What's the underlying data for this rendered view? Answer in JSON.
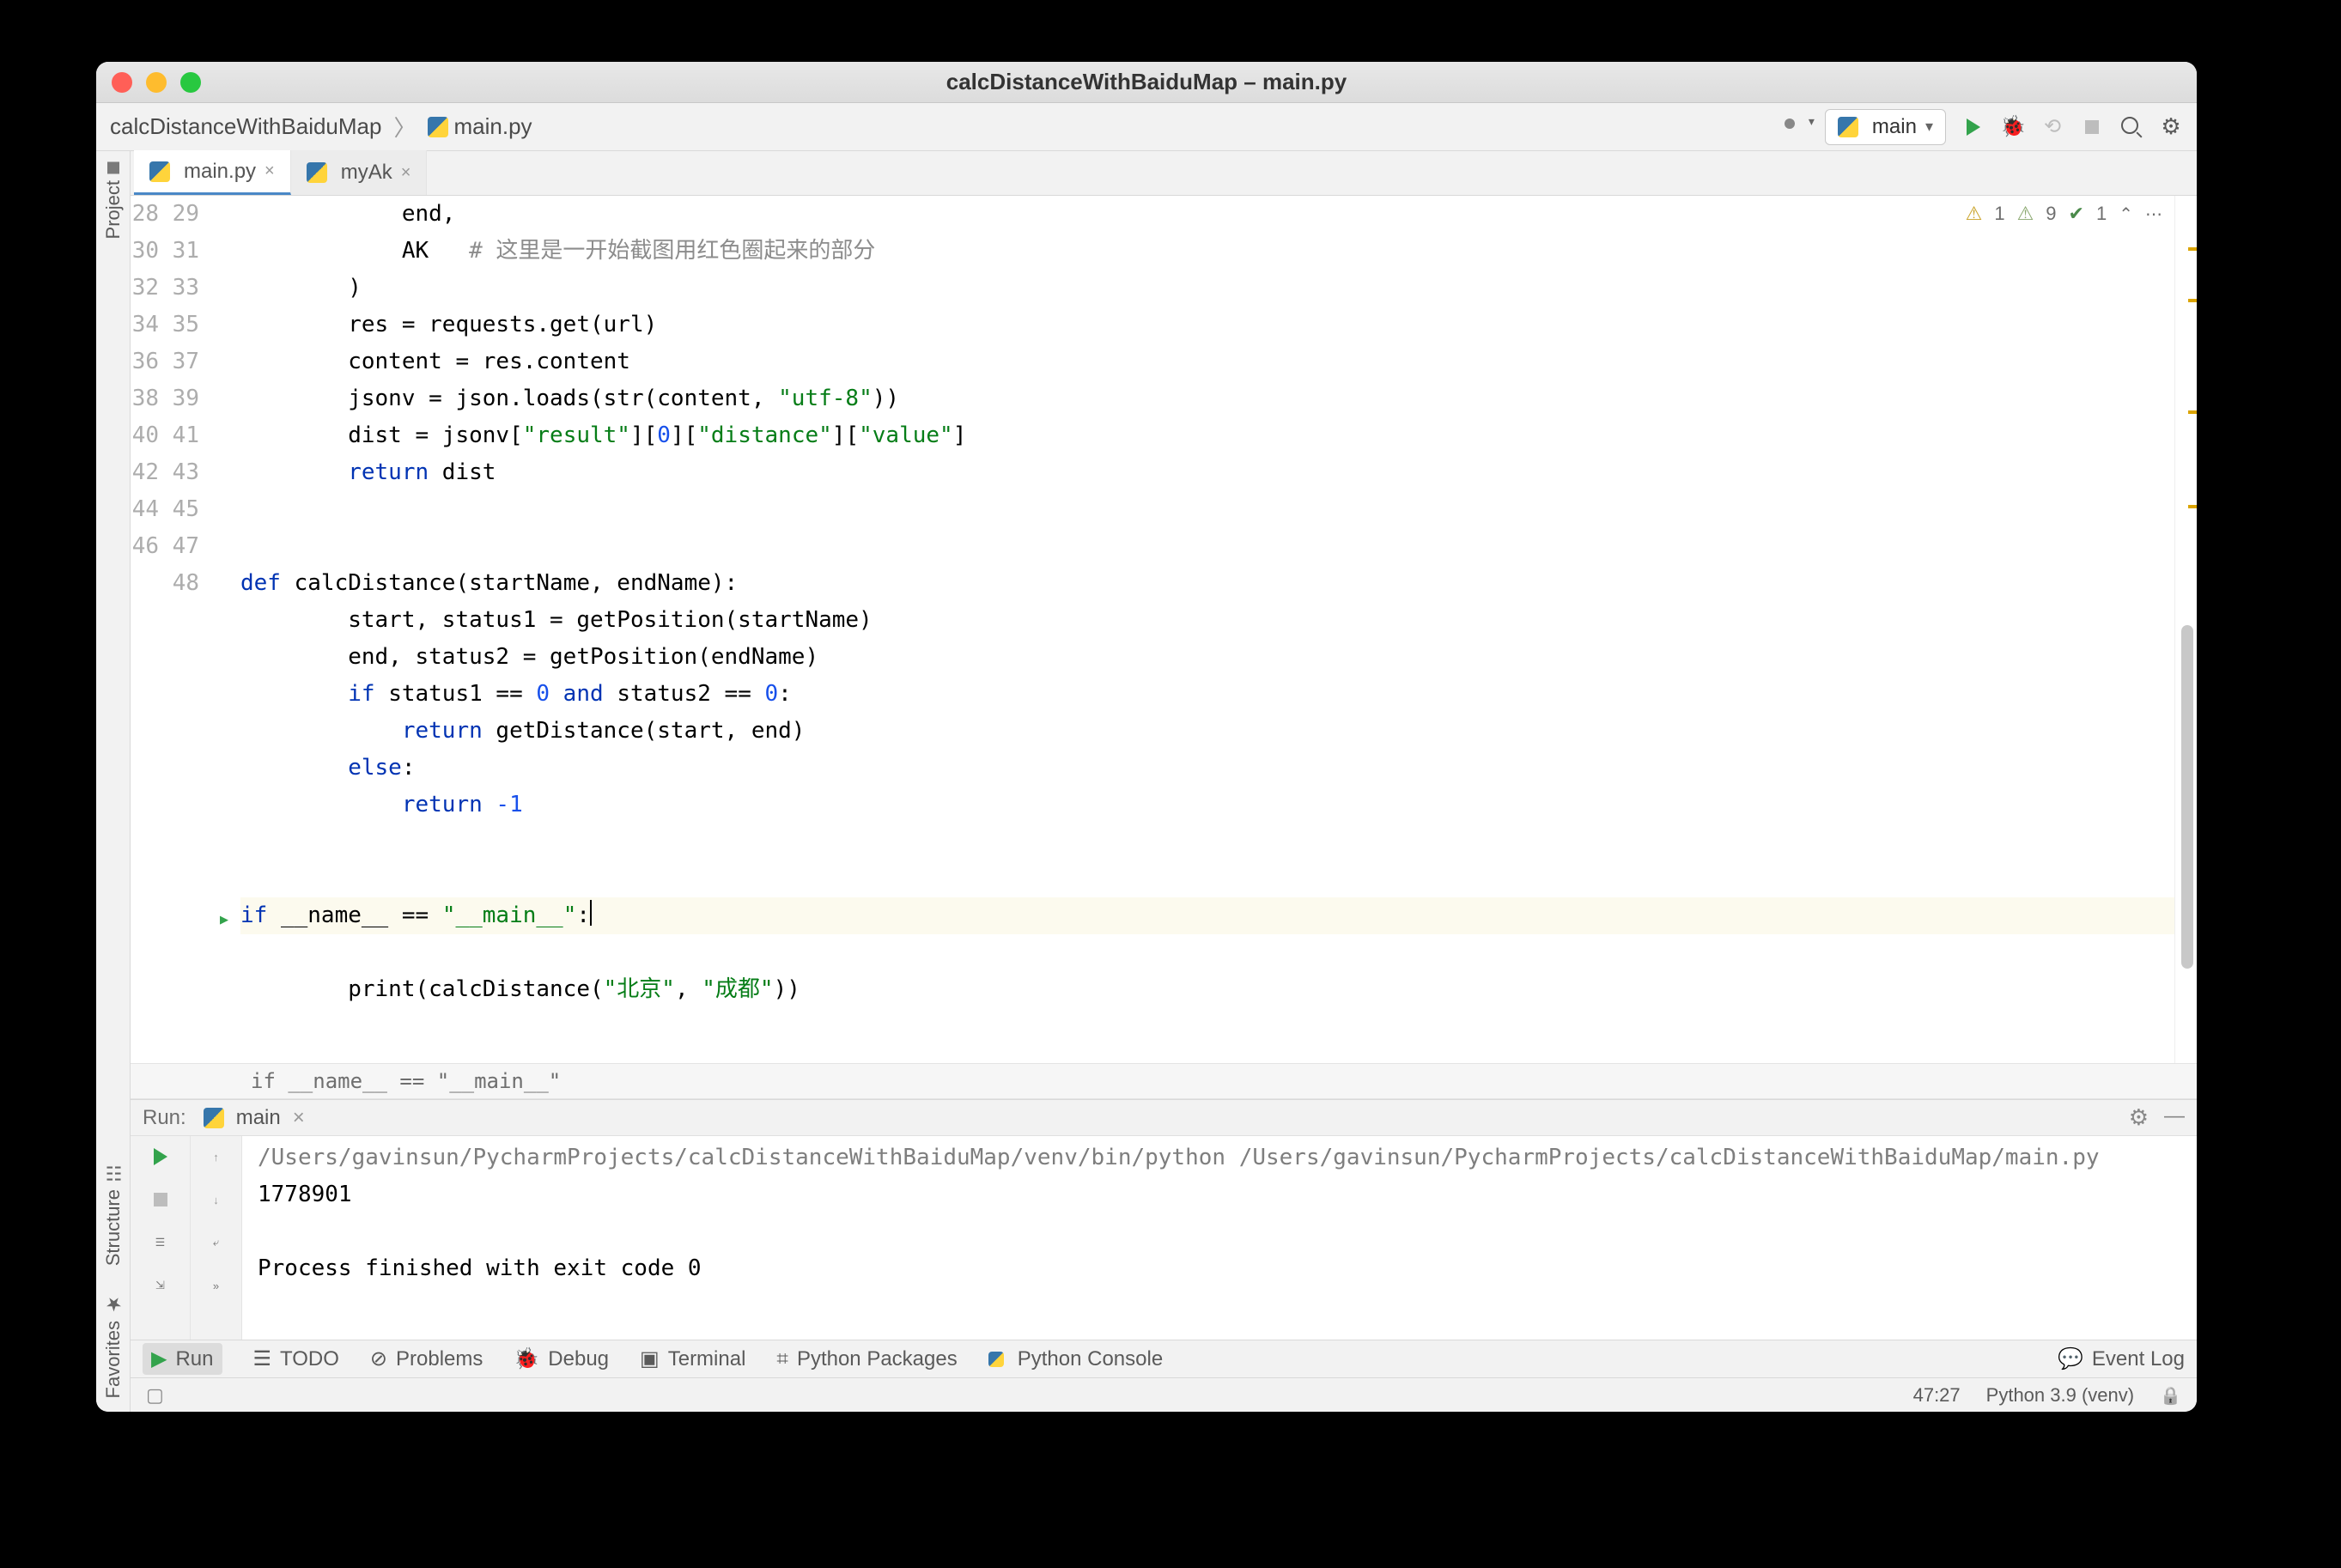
{
  "window": {
    "title": "calcDistanceWithBaiduMap – main.py"
  },
  "breadcrumb": {
    "project": "calcDistanceWithBaiduMap",
    "file": "main.py"
  },
  "runConfig": {
    "name": "main"
  },
  "tabs": [
    {
      "label": "main.py",
      "active": true
    },
    {
      "label": "myAk",
      "active": false
    }
  ],
  "inspections": {
    "warnings": "1",
    "typos": "9",
    "ok": "1"
  },
  "gutter": {
    "start": 28,
    "end": 48
  },
  "code": {
    "l28": "            end,",
    "l29a": "            AK   ",
    "l29b": "# 这里是一开始截图用红色圈起来的部分",
    "l30": "        )",
    "l31": "        res = requests.get(url)",
    "l32": "        content = res.content",
    "l33_pre": "        jsonv = json.loads(",
    "l33_str": "str",
    "l33_mid": "(content, ",
    "l33_s": "\"utf-8\"",
    "l33_post": "))",
    "l34_pre": "        dist = jsonv[",
    "l34_s1": "\"result\"",
    "l34_b1": "][",
    "l34_n": "0",
    "l34_b2": "][",
    "l34_s2": "\"distance\"",
    "l34_b3": "][",
    "l34_s3": "\"value\"",
    "l34_post": "]",
    "l35_kw": "        return",
    "l35_rest": " dist",
    "l38_kw": "def ",
    "l38_rest": "calcDistance(startName, endName):",
    "l39": "        start, status1 = getPosition(startName)",
    "l40": "        end, status2 = getPosition(endName)",
    "l41_if": "        if ",
    "l41_a": "status1 == ",
    "l41_n1": "0",
    "l41_and": " and ",
    "l41_b": "status2 == ",
    "l41_n2": "0",
    "l41_post": ":",
    "l42_kw": "            return ",
    "l42_rest": "getDistance(start, end)",
    "l43_kw": "        else",
    "l43_post": ":",
    "l44_kw": "            return ",
    "l44_n": "-1",
    "l47_if": "if ",
    "l47_name": "__name__ == ",
    "l47_s": "\"__main__\"",
    "l47_post": ":",
    "l48_pre": "        print(calcDistance(",
    "l48_s1": "\"北京\"",
    "l48_c": ", ",
    "l48_s2": "\"成都\"",
    "l48_post": "))"
  },
  "breadcrumbBar": "if __name__ == \"__main__\"",
  "run": {
    "label": "Run:",
    "config": "main",
    "cmd": "/Users/gavinsun/PycharmProjects/calcDistanceWithBaiduMap/venv/bin/python /Users/gavinsun/PycharmProjects/calcDistanceWithBaiduMap/main.py",
    "out": "1778901",
    "exit": "Process finished with exit code 0"
  },
  "toolWindows": {
    "run": "Run",
    "todo": "TODO",
    "problems": "Problems",
    "debug": "Debug",
    "terminal": "Terminal",
    "pypkg": "Python Packages",
    "pyconsole": "Python Console",
    "eventlog": "Event Log"
  },
  "sideTabs": {
    "project": "Project",
    "structure": "Structure",
    "favorites": "Favorites"
  },
  "status": {
    "pos": "47:27",
    "interpreter": "Python 3.9 (venv)"
  }
}
